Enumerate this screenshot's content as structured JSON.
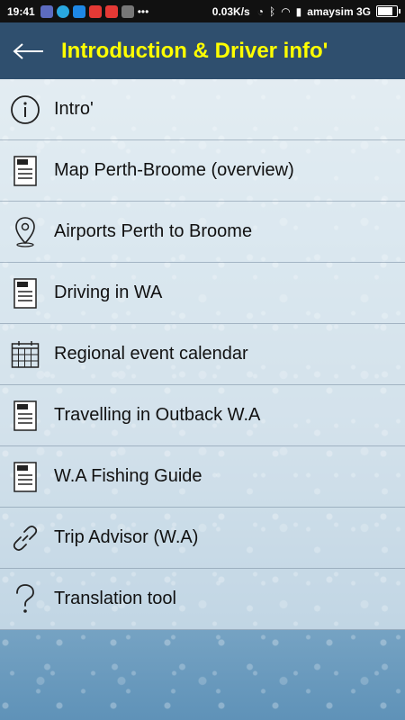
{
  "status_bar": {
    "time": "19:41",
    "speed": "0.03K/s",
    "carrier": "amaysim 3G",
    "battery_level": 0.8
  },
  "app_bar": {
    "back_icon": "arrow-left-icon",
    "title": "Introduction & Driver info'"
  },
  "menu": {
    "items": [
      {
        "label": "Intro'",
        "icon": "info-icon"
      },
      {
        "label": "Map Perth-Broome (overview)",
        "icon": "pdf-document-icon"
      },
      {
        "label": "Airports Perth to Broome",
        "icon": "map-pin-icon"
      },
      {
        "label": "Driving in WA",
        "icon": "pdf-document-icon"
      },
      {
        "label": "Regional event calendar",
        "icon": "calendar-icon"
      },
      {
        "label": "Travelling in Outback W.A",
        "icon": "pdf-document-icon"
      },
      {
        "label": "W.A Fishing Guide",
        "icon": "pdf-document-icon"
      },
      {
        "label": "Trip Advisor (W.A)",
        "icon": "link-icon"
      },
      {
        "label": "Translation tool",
        "icon": "question-mark-icon"
      }
    ]
  }
}
